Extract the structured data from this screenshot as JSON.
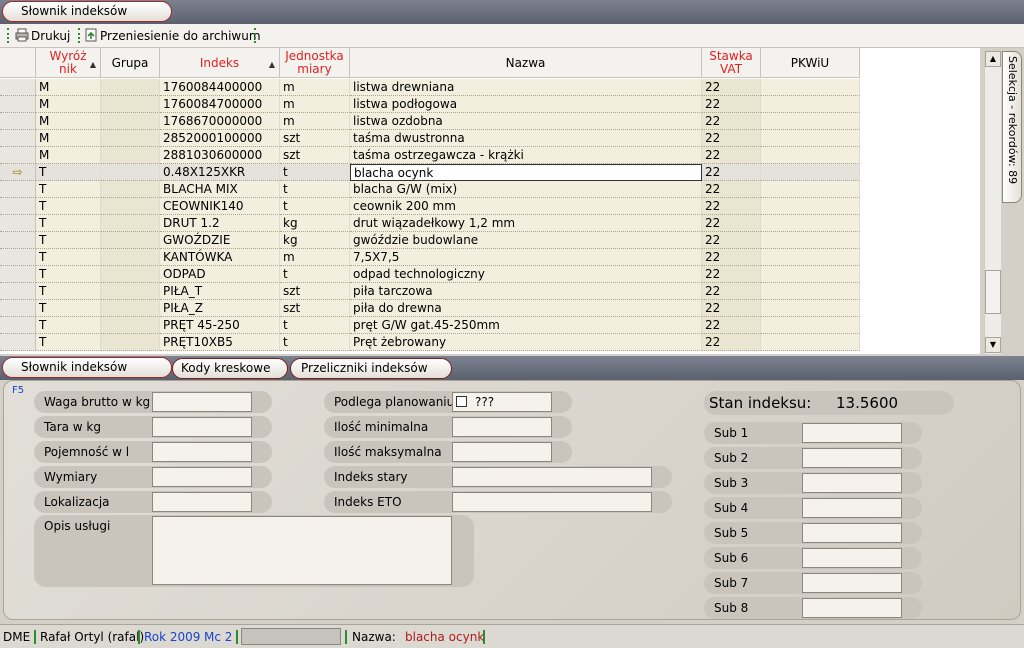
{
  "top_tab": {
    "label": "Słownik indeksów"
  },
  "toolbar": {
    "print": "Drukuj",
    "archive": "Przeniesienie do archiwum"
  },
  "grid": {
    "headers": [
      "Wyróżnik",
      "Grupa",
      "Indeks",
      "Jednostka miary",
      "Nazwa",
      "Stawka VAT",
      "PKWiU"
    ],
    "rows": [
      [
        "M",
        "",
        "1760084400000",
        "m",
        "listwa drewniana",
        "22",
        ""
      ],
      [
        "M",
        "",
        "1760084700000",
        "m",
        "listwa podłogowa",
        "22",
        ""
      ],
      [
        "M",
        "",
        "1768670000000",
        "m",
        "listwa ozdobna",
        "22",
        ""
      ],
      [
        "M",
        "",
        "2852000100000",
        "szt",
        "taśma dwustronna",
        "22",
        ""
      ],
      [
        "M",
        "",
        "2881030600000",
        "szt",
        "taśma ostrzegawcza - krążki",
        "22",
        ""
      ],
      [
        "T",
        "",
        "0.48X125XKR",
        "t",
        "blacha ocynk",
        "22",
        ""
      ],
      [
        "T",
        "",
        "BLACHA MIX",
        "t",
        "blacha G/W (mix)",
        "22",
        ""
      ],
      [
        "T",
        "",
        "CEOWNIK140",
        "t",
        "ceownik 200 mm",
        "22",
        ""
      ],
      [
        "T",
        "",
        "DRUT 1.2",
        "kg",
        "drut wiązadełkowy 1,2 mm",
        "22",
        ""
      ],
      [
        "T",
        "",
        "GWOŹDZIE",
        "kg",
        "gwóździe budowlane",
        "22",
        ""
      ],
      [
        "T",
        "",
        "KANTÓWKA",
        "m",
        "7,5X7,5",
        "22",
        ""
      ],
      [
        "T",
        "",
        "ODPAD",
        "t",
        "odpad technologiczny",
        "22",
        ""
      ],
      [
        "T",
        "",
        "PIŁA_T",
        "szt",
        "piła tarczowa",
        "22",
        ""
      ],
      [
        "T",
        "",
        "PIŁA_Z",
        "szt",
        "piła do drewna",
        "22",
        ""
      ],
      [
        "T",
        "",
        "PRĘT 45-250",
        "t",
        "pręt G/W gat.45-250mm",
        "22",
        ""
      ],
      [
        "T",
        "",
        "PRĘT10XB5",
        "t",
        "Pręt żebrowany",
        "22",
        ""
      ]
    ],
    "selected_row": 5,
    "row_indicator": "⇨"
  },
  "side_tab": {
    "label": "Selekcja - rekordów: 89"
  },
  "bottom_tabs": [
    "Słownik indeksów",
    "Kody kreskowe",
    "Przeliczniki indeksów"
  ],
  "panel": {
    "hint": "F5",
    "left_fields": [
      {
        "label": "Waga brutto w kg",
        "value": ""
      },
      {
        "label": "Tara w kg",
        "value": ""
      },
      {
        "label": "Pojemność w l",
        "value": ""
      },
      {
        "label": "Wymiary",
        "value": ""
      },
      {
        "label": "Lokalizacja",
        "value": ""
      }
    ],
    "opis_label": "Opis usługi",
    "opis_value": "",
    "mid_fields": [
      {
        "label": "Podlega planowaniu",
        "value": "???"
      },
      {
        "label": "Ilość minimalna",
        "value": ""
      },
      {
        "label": "Ilość maksymalna",
        "value": ""
      },
      {
        "label": "Indeks stary",
        "value": ""
      },
      {
        "label": "Indeks ETO",
        "value": ""
      }
    ],
    "stan_label": "Stan indeksu:",
    "stan_value": "13.5600",
    "subs": [
      {
        "label": "Sub 1",
        "value": ""
      },
      {
        "label": "Sub 2",
        "value": ""
      },
      {
        "label": "Sub 3",
        "value": ""
      },
      {
        "label": "Sub 4",
        "value": ""
      },
      {
        "label": "Sub 5",
        "value": ""
      },
      {
        "label": "Sub 6",
        "value": ""
      },
      {
        "label": "Sub 7",
        "value": ""
      },
      {
        "label": "Sub 8",
        "value": ""
      }
    ]
  },
  "status": {
    "app": "DME",
    "user": "Rafał Ortyl (rafal)",
    "year": "Rok 2009",
    "month": "Mc 2",
    "name_label": "Nazwa:",
    "name_value": "blacha ocynk"
  }
}
